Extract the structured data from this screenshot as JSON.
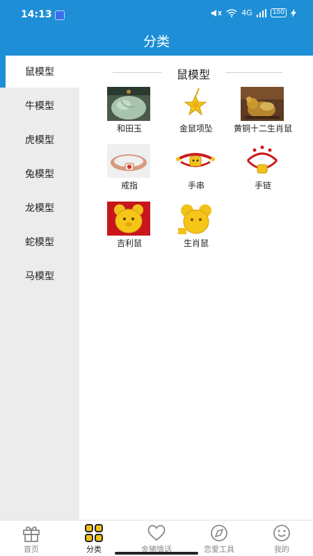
{
  "status": {
    "time": "14:13",
    "battery": "100",
    "network": "4G"
  },
  "header": {
    "title": "分类"
  },
  "sidebar": {
    "items": [
      {
        "label": "鼠模型",
        "active": true
      },
      {
        "label": "牛模型"
      },
      {
        "label": "虎模型"
      },
      {
        "label": "兔模型"
      },
      {
        "label": "龙模型"
      },
      {
        "label": "蛇模型"
      },
      {
        "label": "马模型"
      }
    ]
  },
  "main": {
    "section_title": "鼠模型",
    "products": [
      {
        "label": "和田玉",
        "icon": "jade-pendant-image"
      },
      {
        "label": "金鼠项坠",
        "icon": "gold-star-pendant-image"
      },
      {
        "label": "黄铜十二生肖鼠",
        "icon": "brass-rat-image"
      },
      {
        "label": "戒指",
        "icon": "ring-image"
      },
      {
        "label": "手串",
        "icon": "bead-bracelet-image"
      },
      {
        "label": "手链",
        "icon": "red-bracelet-image"
      },
      {
        "label": "吉利鼠",
        "icon": "lucky-rat-image"
      },
      {
        "label": "生肖鼠",
        "icon": "zodiac-rat-image"
      }
    ]
  },
  "bottom_nav": {
    "items": [
      {
        "label": "首页",
        "icon": "gift-icon"
      },
      {
        "label": "分类",
        "icon": "category-grid-icon",
        "active": true
      },
      {
        "label": "金猪情话",
        "icon": "heart-icon"
      },
      {
        "label": "恋爱工具",
        "icon": "compass-icon"
      },
      {
        "label": "我的",
        "icon": "smiley-icon"
      }
    ]
  },
  "colors": {
    "primary": "#1e8fd6",
    "sidebar_bg": "#ececec",
    "nav_inactive": "#888888",
    "gold": "#f2c21b",
    "red": "#cc1b1b"
  }
}
